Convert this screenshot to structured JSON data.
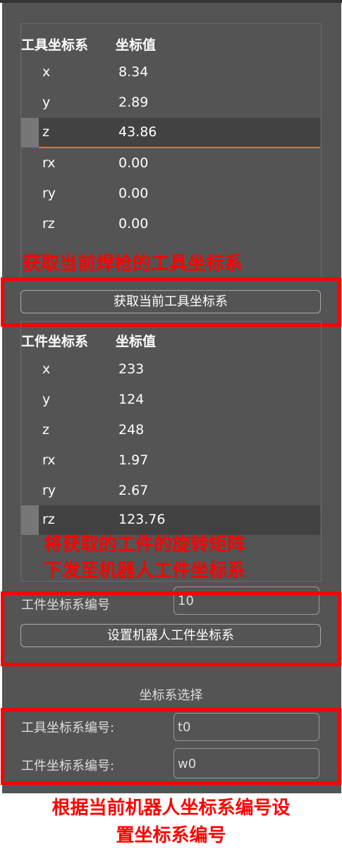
{
  "tool_table": {
    "header_name": "工具坐标系",
    "header_value": "坐标值",
    "rows": [
      {
        "k": "x",
        "v": "8.34"
      },
      {
        "k": "y",
        "v": "2.89"
      },
      {
        "k": "z",
        "v": "43.86"
      },
      {
        "k": "rx",
        "v": "0.00"
      },
      {
        "k": "ry",
        "v": "0.00"
      },
      {
        "k": "rz",
        "v": "0.00"
      }
    ]
  },
  "get_tool_button": "获取当前工具坐标系",
  "work_table": {
    "header_name": "工件坐标系",
    "header_value": "坐标值",
    "rows": [
      {
        "k": "x",
        "v": "233"
      },
      {
        "k": "y",
        "v": "124"
      },
      {
        "k": "z",
        "v": "248"
      },
      {
        "k": "rx",
        "v": "1.97"
      },
      {
        "k": "ry",
        "v": "2.67"
      },
      {
        "k": "rz",
        "v": "123.76"
      }
    ]
  },
  "work_number_label": "工件坐标系编号",
  "work_number_value": "10",
  "set_work_button": "设置机器人工件坐标系",
  "select_title": "坐标系选择",
  "tool_no_label": "工具坐标系编号:",
  "tool_no_value": "t0",
  "work_no_label": "工件坐标系编号:",
  "work_no_value": "w0",
  "annotations": {
    "a1": "获取当前焊枪的工具坐标系",
    "a2_line1": "将获取的工件的旋转矩阵",
    "a2_line2": "下发至机器人工件坐标系",
    "a3_line1": "根据当前机器人坐标系编号设",
    "a3_line2": "置坐标系编号"
  },
  "colors": {
    "panel": "#545454",
    "highlight": "#e87510",
    "annotation": "#ff0000"
  }
}
